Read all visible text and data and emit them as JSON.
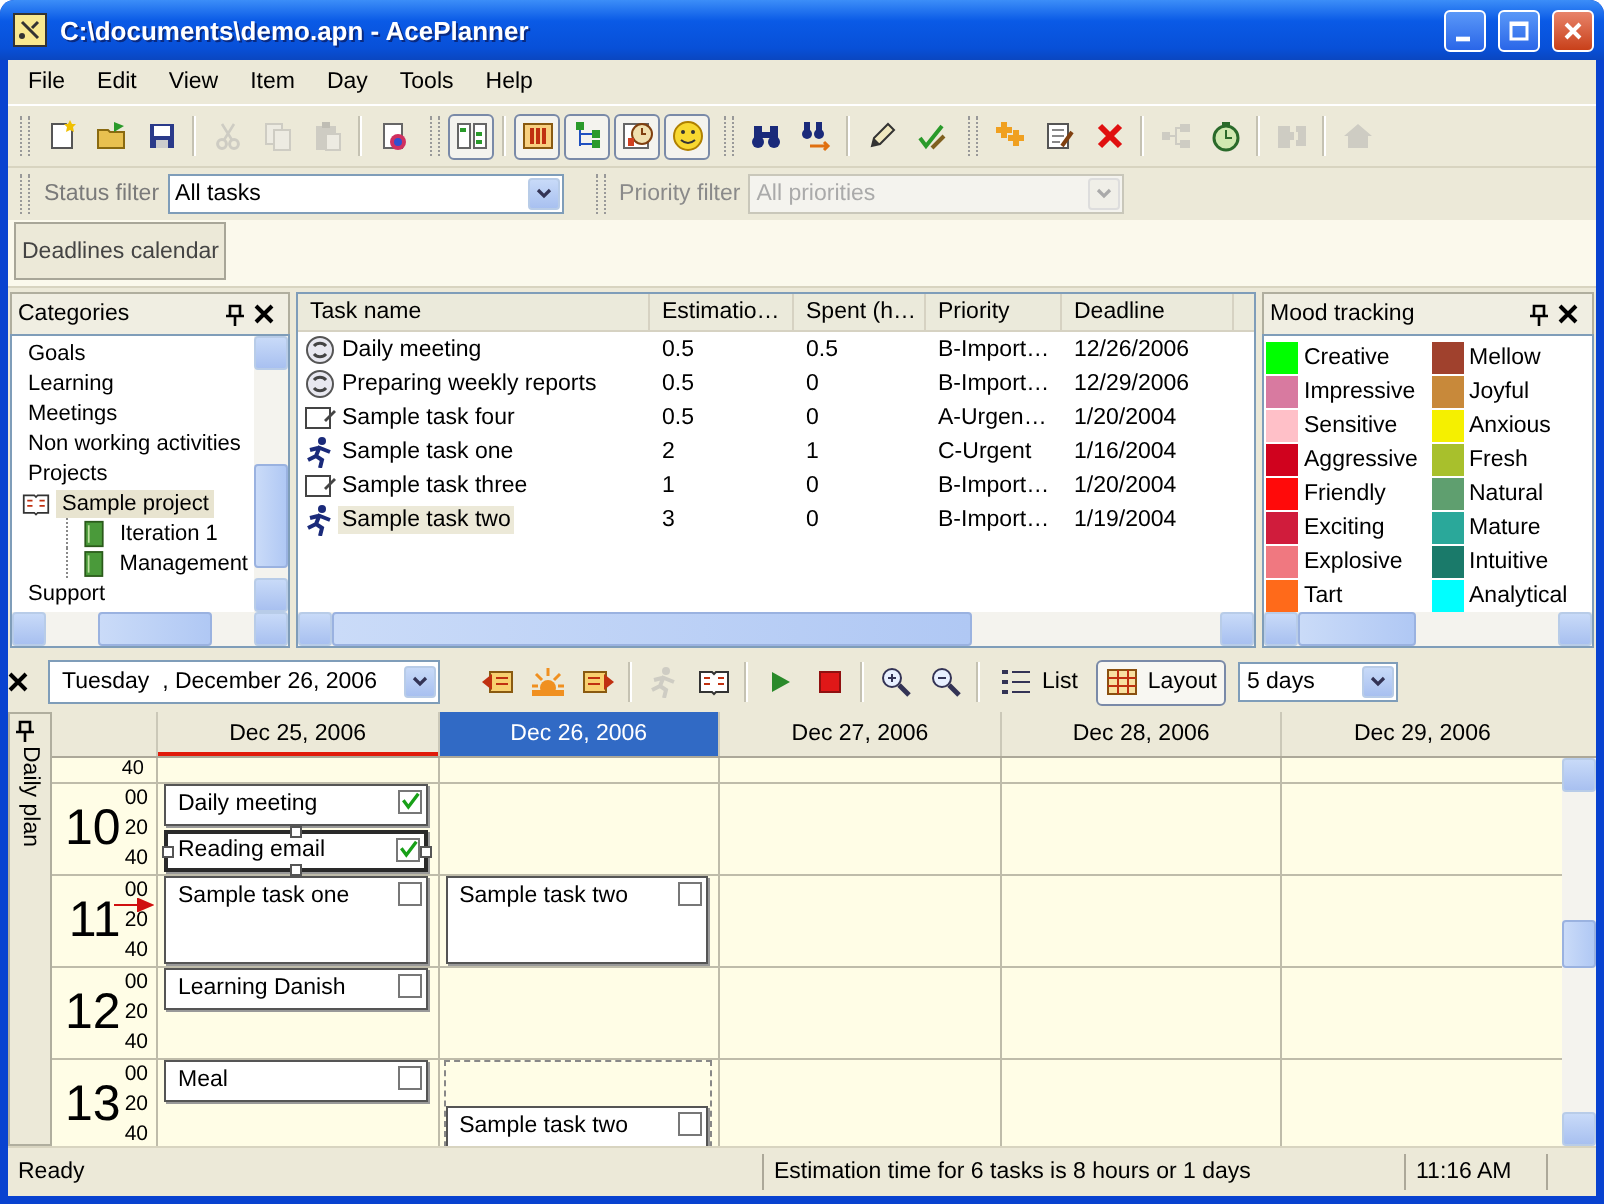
{
  "window": {
    "title": "C:\\documents\\demo.apn - AcePlanner"
  },
  "menu": [
    "File",
    "Edit",
    "View",
    "Item",
    "Day",
    "Tools",
    "Help"
  ],
  "toolbar": [
    [
      [
        {
          "kind": "new",
          "on": false,
          "disabled": false
        },
        {
          "kind": "open",
          "on": false,
          "disabled": false
        },
        {
          "kind": "save",
          "on": false,
          "disabled": false
        }
      ],
      [
        {
          "kind": "cut",
          "on": false,
          "disabled": true
        },
        {
          "kind": "copy",
          "on": false,
          "disabled": true
        },
        {
          "kind": "paste",
          "on": false,
          "disabled": true
        }
      ],
      [
        {
          "kind": "print",
          "on": false,
          "disabled": false
        }
      ]
    ],
    [
      [
        {
          "kind": "categories",
          "on": true,
          "disabled": false
        }
      ],
      [
        {
          "kind": "columns",
          "on": true,
          "disabled": false
        },
        {
          "kind": "tree",
          "on": true,
          "disabled": false
        },
        {
          "kind": "chart",
          "on": true,
          "disabled": false
        },
        {
          "kind": "mood",
          "on": true,
          "disabled": false
        }
      ]
    ],
    [
      [
        {
          "kind": "find",
          "on": false,
          "disabled": false
        },
        {
          "kind": "find-next",
          "on": false,
          "disabled": false
        }
      ],
      [
        {
          "kind": "edit",
          "on": false,
          "disabled": false
        },
        {
          "kind": "check",
          "on": false,
          "disabled": false
        }
      ]
    ],
    [
      [
        {
          "kind": "add",
          "on": false,
          "disabled": false
        },
        {
          "kind": "properties",
          "on": false,
          "disabled": false
        },
        {
          "kind": "delete",
          "on": false,
          "disabled": false
        }
      ],
      [
        {
          "kind": "hierarchy",
          "on": false,
          "disabled": true
        },
        {
          "kind": "timer",
          "on": false,
          "disabled": false
        }
      ],
      [
        {
          "kind": "puzzle",
          "on": false,
          "disabled": true
        }
      ],
      [
        {
          "kind": "home",
          "on": false,
          "disabled": true
        }
      ]
    ]
  ],
  "filters": [
    {
      "label": "Status filter",
      "value": "All tasks",
      "disabled": false
    },
    {
      "label": "Priority filter",
      "value": "All priorities",
      "disabled": true
    }
  ],
  "deadlines_button": "Deadlines calendar",
  "categories": {
    "title": "Categories",
    "items": [
      {
        "label": "Goals",
        "selected": false
      },
      {
        "label": "Learning",
        "selected": false
      },
      {
        "label": "Meetings",
        "selected": false
      },
      {
        "label": "Non working activities",
        "selected": false
      },
      {
        "label": "Projects",
        "selected": false
      },
      {
        "label": "Sample project",
        "selected": true,
        "children": [
          {
            "label": "Iteration 1",
            "selected": false
          },
          {
            "label": "Management",
            "selected": false
          }
        ]
      },
      {
        "label": "Support",
        "selected": false
      }
    ]
  },
  "tasks": {
    "columns": [
      "Task name",
      "Estimatio…",
      "Spent (h…",
      "Priority",
      "Deadline"
    ],
    "rows": [
      {
        "kind": "recurring",
        "name": "Daily meeting",
        "estimation": "0.5",
        "spent": "0.5",
        "priority": "B-Import…",
        "deadline": "12/26/2006",
        "selected": false
      },
      {
        "kind": "recurring",
        "name": "Preparing weekly reports",
        "estimation": "0.5",
        "spent": "0",
        "priority": "B-Import…",
        "deadline": "12/29/2006",
        "selected": false
      },
      {
        "kind": "note",
        "name": "Sample task four",
        "estimation": "0.5",
        "spent": "0",
        "priority": "A-Urgen…",
        "deadline": "1/20/2004",
        "selected": false
      },
      {
        "kind": "running",
        "name": "Sample task one",
        "estimation": "2",
        "spent": "1",
        "priority": "C-Urgent",
        "deadline": "1/16/2004",
        "selected": false
      },
      {
        "kind": "note",
        "name": "Sample task three",
        "estimation": "1",
        "spent": "0",
        "priority": "B-Import…",
        "deadline": "1/20/2004",
        "selected": false
      },
      {
        "kind": "running",
        "name": "Sample task two",
        "estimation": "3",
        "spent": "0",
        "priority": "B-Import…",
        "deadline": "1/19/2004",
        "selected": true
      }
    ]
  },
  "mood": {
    "title": "Mood tracking",
    "items": [
      {
        "label": "Creative",
        "color": "#00ff00"
      },
      {
        "label": "Mellow",
        "color": "#a0412d"
      },
      {
        "label": "Impressive",
        "color": "#d87aa0"
      },
      {
        "label": "Joyful",
        "color": "#c8893a"
      },
      {
        "label": "Sensitive",
        "color": "#ffc0c8"
      },
      {
        "label": "Anxious",
        "color": "#f5f000"
      },
      {
        "label": "Aggressive",
        "color": "#d0021e"
      },
      {
        "label": "Fresh",
        "color": "#a8c02c"
      },
      {
        "label": "Friendly",
        "color": "#ff0a0a"
      },
      {
        "label": "Natural",
        "color": "#5f9f6f"
      },
      {
        "label": "Exciting",
        "color": "#d01c3c"
      },
      {
        "label": "Mature",
        "color": "#2aa89a"
      },
      {
        "label": "Explosive",
        "color": "#f07880"
      },
      {
        "label": "Intuitive",
        "color": "#1a7a6a"
      },
      {
        "label": "Tart",
        "color": "#ff6a1a"
      },
      {
        "label": "Analytical",
        "color": "#00ffff"
      }
    ]
  },
  "day_plan": {
    "panel_title": "Daily plan",
    "weekday": "Tuesday",
    "date": ", December 26, 2006",
    "tools": [
      [
        {
          "kind": "prev-day",
          "disabled": false
        },
        {
          "kind": "today",
          "disabled": false
        },
        {
          "kind": "next-day",
          "disabled": false
        }
      ],
      [
        {
          "kind": "runner",
          "disabled": true
        },
        {
          "kind": "book",
          "disabled": false
        }
      ],
      [
        {
          "kind": "play",
          "disabled": false
        },
        {
          "kind": "stop",
          "disabled": false
        }
      ],
      [
        {
          "kind": "zoom-in",
          "disabled": false
        },
        {
          "kind": "zoom-out",
          "disabled": false
        }
      ]
    ],
    "list_button": "List",
    "layout_button": {
      "label": "Layout",
      "on": true
    },
    "range": "5 days",
    "top_minute": "40",
    "hours": [
      {
        "hour": "10",
        "minutes": [
          "00",
          "20",
          "40"
        ],
        "current": false
      },
      {
        "hour": "11",
        "minutes": [
          "00",
          "20",
          "40"
        ],
        "current": true
      },
      {
        "hour": "12",
        "minutes": [
          "00",
          "20",
          "40"
        ],
        "current": false
      },
      {
        "hour": "13",
        "minutes": [
          "00",
          "20",
          "40"
        ],
        "current": false
      }
    ],
    "days": [
      {
        "label": "Dec 25, 2006",
        "today": true,
        "selected": false,
        "events": [
          {
            "kind": "half-task",
            "title": "Daily meeting",
            "checked": true,
            "selected": false
          },
          {
            "kind": "half-task",
            "title": "Reading email",
            "checked": true,
            "selected": true
          },
          {
            "kind": "hour-task",
            "title": "Sample task one",
            "checked": false,
            "selected": false
          },
          {
            "kind": "half-task",
            "title": "Learning Danish",
            "checked": false,
            "selected": false
          },
          {
            "kind": "half-gap"
          },
          {
            "kind": "half-task",
            "title": "Meal",
            "checked": false,
            "selected": false
          }
        ]
      },
      {
        "label": "Dec 26, 2006",
        "today": false,
        "selected": true,
        "events": [
          {
            "kind": "hour-gap"
          },
          {
            "kind": "hour-task",
            "title": "Sample task two",
            "checked": false,
            "selected": false
          },
          {
            "kind": "hour-gap"
          },
          {
            "kind": "outline",
            "children": [
              {
                "kind": "half-gap"
              },
              {
                "kind": "hour-task",
                "title": "Sample task two",
                "checked": false,
                "selected": false
              }
            ]
          }
        ]
      },
      {
        "label": "Dec 27, 2006",
        "today": false,
        "selected": false
      },
      {
        "label": "Dec 28, 2006",
        "today": false,
        "selected": false
      },
      {
        "label": "Dec 29, 2006",
        "today": false,
        "selected": false
      }
    ]
  },
  "status_bar": [
    "Ready",
    "Estimation time for 6 tasks is 8 hours or 1 days",
    "11:16 AM"
  ]
}
